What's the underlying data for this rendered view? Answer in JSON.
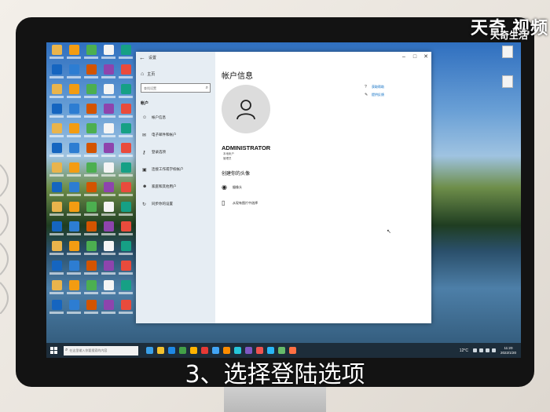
{
  "caption": "3、选择登陆选项",
  "watermark": {
    "text": "天奇 视频",
    "logo": "天奇生活"
  },
  "settings": {
    "window_title": "设置",
    "nav": {
      "home_label": "主页",
      "search_placeholder": "查找设置",
      "section_label": "帐户",
      "items": [
        {
          "label": "帐户信息",
          "icon": "user-icon"
        },
        {
          "label": "电子邮件和帐户",
          "icon": "mail-icon"
        },
        {
          "label": "登录选项",
          "icon": "key-icon"
        },
        {
          "label": "连接工作或学校帐户",
          "icon": "briefcase-icon"
        },
        {
          "label": "家庭和其他用户",
          "icon": "people-icon"
        },
        {
          "label": "同步你的设置",
          "icon": "sync-icon"
        }
      ]
    },
    "main": {
      "page_title": "帐户信息",
      "username": "ADMINISTRATOR",
      "account_type": "本地帐户",
      "account_role": "管理员",
      "create_section_title": "创建你的头像",
      "options": [
        {
          "label": "摄像头",
          "icon": "camera-icon"
        },
        {
          "label": "从现有图片中选择",
          "icon": "image-icon"
        }
      ],
      "links": [
        {
          "label": "获取帮助",
          "icon": "help-icon"
        },
        {
          "label": "提供反馈",
          "icon": "feedback-icon"
        }
      ]
    }
  },
  "taskbar": {
    "search_placeholder": "在这里输入你要搜索的内容",
    "weather": "12°C",
    "time": "11:20",
    "date": "2022/1/20"
  },
  "colors": {
    "taskbar_bg": "#1d2d3a",
    "nav_bg": "#e6edf3",
    "link": "#0067c0"
  }
}
